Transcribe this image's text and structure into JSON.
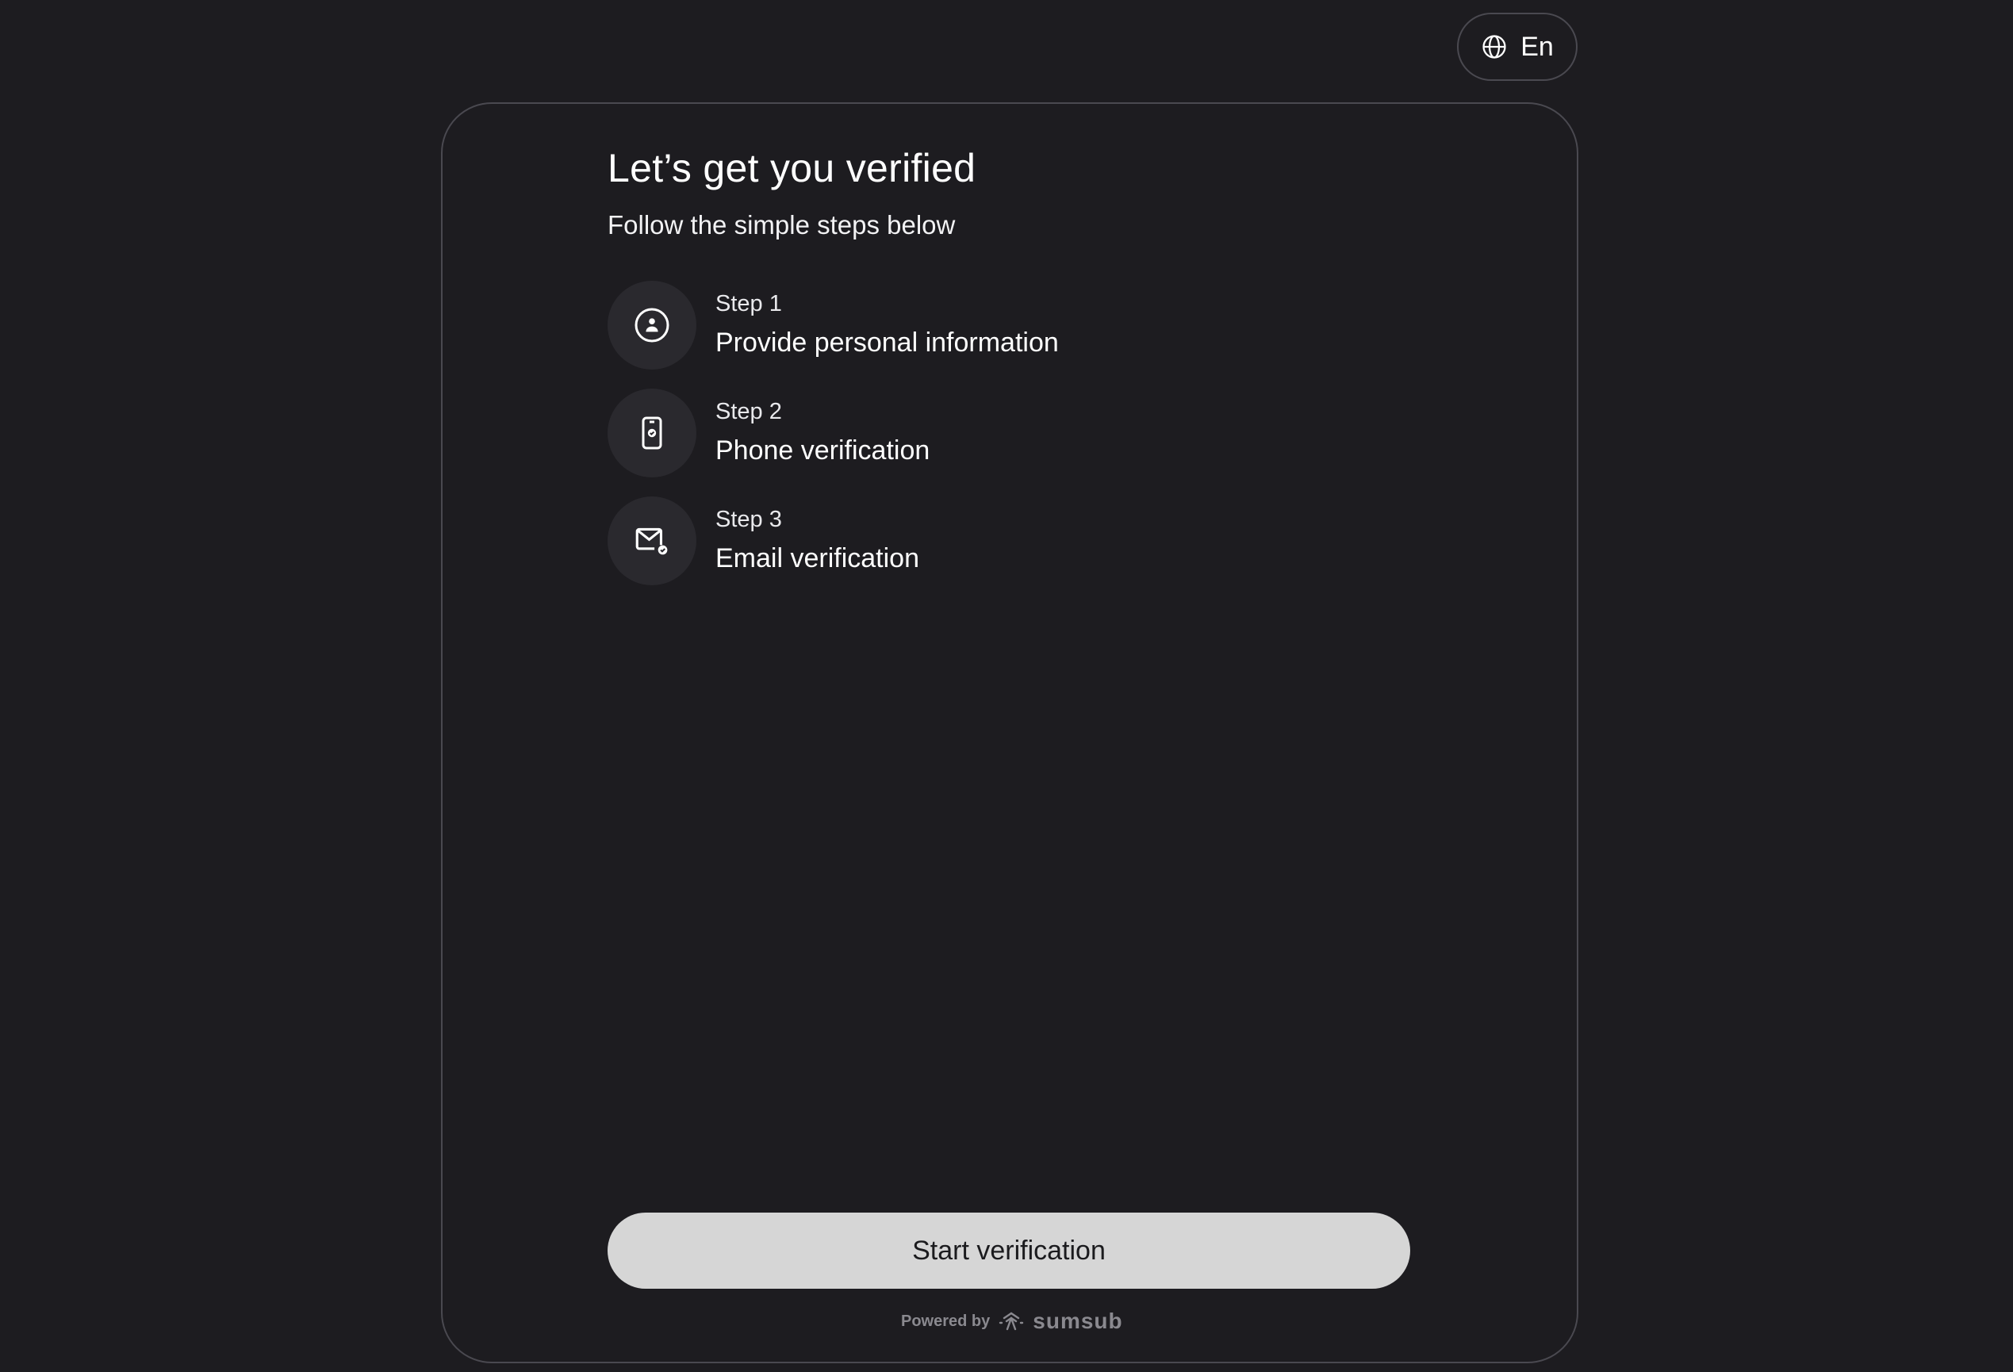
{
  "language": {
    "label": "En",
    "icon": "globe-icon"
  },
  "header": {
    "title": "Let’s get you verified",
    "subtitle": "Follow the simple steps below"
  },
  "steps": [
    {
      "number": "Step 1",
      "title": "Provide personal information",
      "icon": "person-icon"
    },
    {
      "number": "Step 2",
      "title": "Phone verification",
      "icon": "phone-check-icon"
    },
    {
      "number": "Step 3",
      "title": "Email verification",
      "icon": "email-check-icon"
    }
  ],
  "actions": {
    "start_label": "Start verification"
  },
  "footer": {
    "powered_by": "Powered by",
    "brand": "sumsub",
    "brand_icon": "sumsub-logo-icon"
  },
  "colors": {
    "background": "#1d1c20",
    "border": "#4a4950",
    "icon_circle": "#2a292e",
    "button_bg": "#d6d6d6",
    "button_text": "#1b1b1e",
    "muted_text": "#8a898f"
  }
}
